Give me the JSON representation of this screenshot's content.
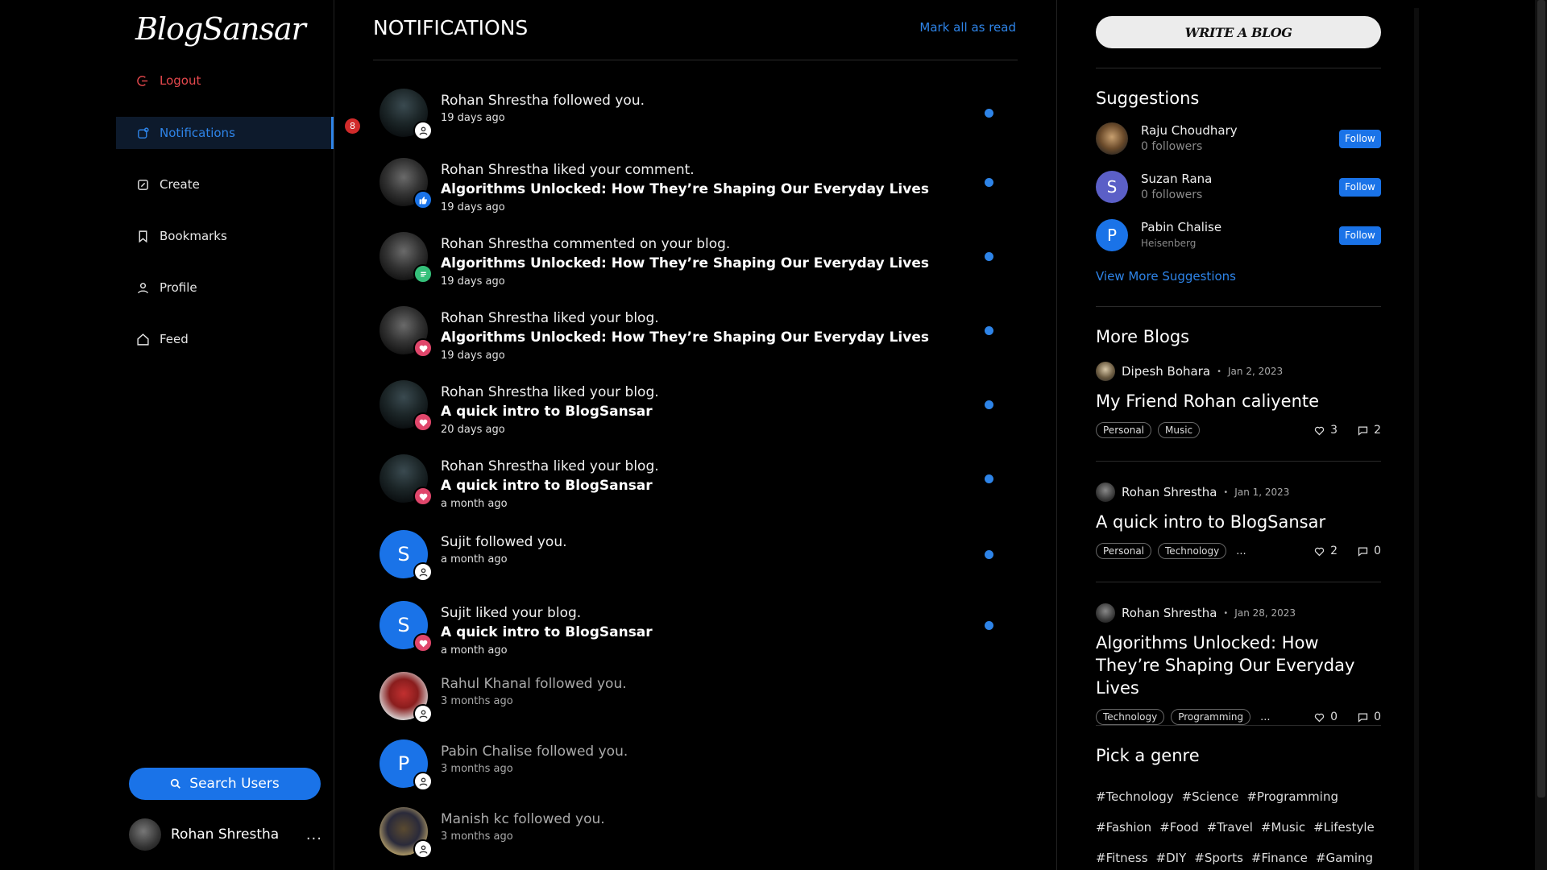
{
  "app": {
    "logo": "BlogSansar"
  },
  "sidebar": {
    "logout": "Logout",
    "notifications": {
      "label": "Notifications",
      "badge": "8"
    },
    "items": [
      {
        "label": "Create",
        "icon": "edit-icon"
      },
      {
        "label": "Bookmarks",
        "icon": "bookmark-icon"
      },
      {
        "label": "Profile",
        "icon": "user-icon"
      },
      {
        "label": "Feed",
        "icon": "home-icon"
      }
    ],
    "search_button": "Search Users",
    "current_user": {
      "name": "Rohan Shrestha",
      "more": "..."
    }
  },
  "main": {
    "title": "NOTIFICATIONS",
    "mark_all": "Mark all as read",
    "notifications": [
      {
        "text": "Rohan Shrestha followed you.",
        "blog": "",
        "time": "19 days ago",
        "type": "follow",
        "unread": true
      },
      {
        "text": "Rohan Shrestha liked your comment.",
        "blog": "Algorithms Unlocked: How They’re Shaping Our Everyday Lives",
        "time": "19 days ago",
        "type": "thumb",
        "unread": true
      },
      {
        "text": "Rohan Shrestha commented on your blog.",
        "blog": "Algorithms Unlocked: How They’re Shaping Our Everyday Lives",
        "time": "19 days ago",
        "type": "comment",
        "unread": true
      },
      {
        "text": "Rohan Shrestha liked your blog.",
        "blog": "Algorithms Unlocked: How They’re Shaping Our Everyday Lives",
        "time": "19 days ago",
        "type": "like",
        "unread": true
      },
      {
        "text": "Rohan Shrestha liked your blog.",
        "blog": "A quick intro to BlogSansar",
        "time": "20 days ago",
        "type": "like",
        "unread": true
      },
      {
        "text": "Rohan Shrestha liked your blog.",
        "blog": "A quick intro to BlogSansar",
        "time": "a month ago",
        "type": "like",
        "unread": true
      },
      {
        "text": "Sujit followed you.",
        "blog": "",
        "time": "a month ago",
        "type": "follow",
        "unread": true,
        "letter": "S"
      },
      {
        "text": "Sujit liked your blog.",
        "blog": "A quick intro to BlogSansar",
        "time": "a month ago",
        "type": "like",
        "unread": true,
        "letter": "S"
      },
      {
        "text": "Rahul Khanal followed you.",
        "blog": "",
        "time": "3 months ago",
        "type": "follow",
        "unread": false
      },
      {
        "text": "Pabin Chalise followed you.",
        "blog": "",
        "time": "3 months ago",
        "type": "follow",
        "unread": false,
        "letter": "P"
      },
      {
        "text": "Manish kc followed you.",
        "blog": "",
        "time": "3 months ago",
        "type": "follow",
        "unread": false
      }
    ]
  },
  "right": {
    "write_button": "WRITE A BLOG",
    "suggestions_title": "Suggestions",
    "suggestions": [
      {
        "name": "Raju Choudhary",
        "sub": "0 followers",
        "follow": "Follow"
      },
      {
        "name": "Suzan Rana",
        "sub": "0 followers",
        "follow": "Follow",
        "letter": "S"
      },
      {
        "name": "Pabin Chalise",
        "sub": "Heisenberg",
        "follow": "Follow",
        "letter": "P"
      }
    ],
    "view_more": "View More Suggestions",
    "more_blogs_title": "More Blogs",
    "blogs": [
      {
        "author": "Dipesh Bohara",
        "date": "Jan 2, 2023",
        "title": "My Friend Rohan caliyente",
        "tags": [
          "Personal",
          "Music"
        ],
        "more": "",
        "likes": "3",
        "comments": "2"
      },
      {
        "author": "Rohan Shrestha",
        "date": "Jan 1, 2023",
        "title": "A quick intro to BlogSansar",
        "tags": [
          "Personal",
          "Technology"
        ],
        "more": "...",
        "likes": "2",
        "comments": "0"
      },
      {
        "author": "Rohan Shrestha",
        "date": "Jan 28, 2023",
        "title": "Algorithms Unlocked: How They’re Shaping Our Everyday Lives",
        "tags": [
          "Technology",
          "Programming"
        ],
        "more": "...",
        "likes": "0",
        "comments": "0"
      }
    ],
    "genre_title": "Pick a genre",
    "genres": [
      [
        "#Technology",
        "#Science",
        "#Programming"
      ],
      [
        "#Fashion",
        "#Food",
        "#Travel",
        "#Music",
        "#Lifestyle"
      ],
      [
        "#Fitness",
        "#DIY",
        "#Sports",
        "#Finance",
        "#Gaming"
      ]
    ]
  },
  "colors": {
    "accent": "#1a73e8",
    "link": "#2e84e8",
    "danger": "#e5484d",
    "badge": "#d12b2b"
  }
}
